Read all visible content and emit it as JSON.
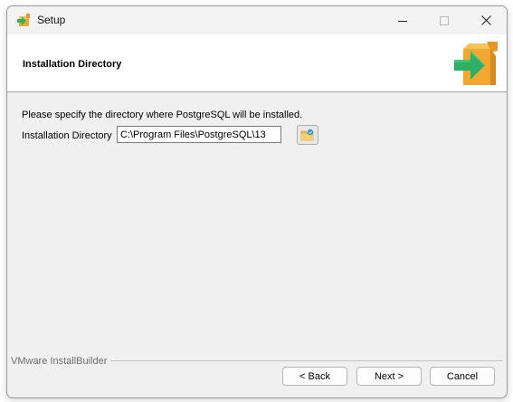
{
  "window": {
    "title": "Setup",
    "controls": {
      "minimize": "—",
      "maximize": "☐",
      "close": "✕"
    }
  },
  "header": {
    "title": "Installation Directory",
    "logo_icon": "package-arrow-icon"
  },
  "main": {
    "prompt": "Please specify the directory where PostgreSQL will be installed.",
    "dir_label": "Installation Directory",
    "dir_value": "C:\\Program Files\\PostgreSQL\\13",
    "browse_icon": "folder-browse-icon"
  },
  "footer": {
    "brand": "VMware InstallBuilder",
    "back_label": "< Back",
    "next_label": "Next >",
    "cancel_label": "Cancel"
  },
  "colors": {
    "window_bg": "#f0f0f0",
    "header_bg": "#ffffff",
    "accent_green": "#2fae66",
    "box_orange": "#f0a830"
  }
}
